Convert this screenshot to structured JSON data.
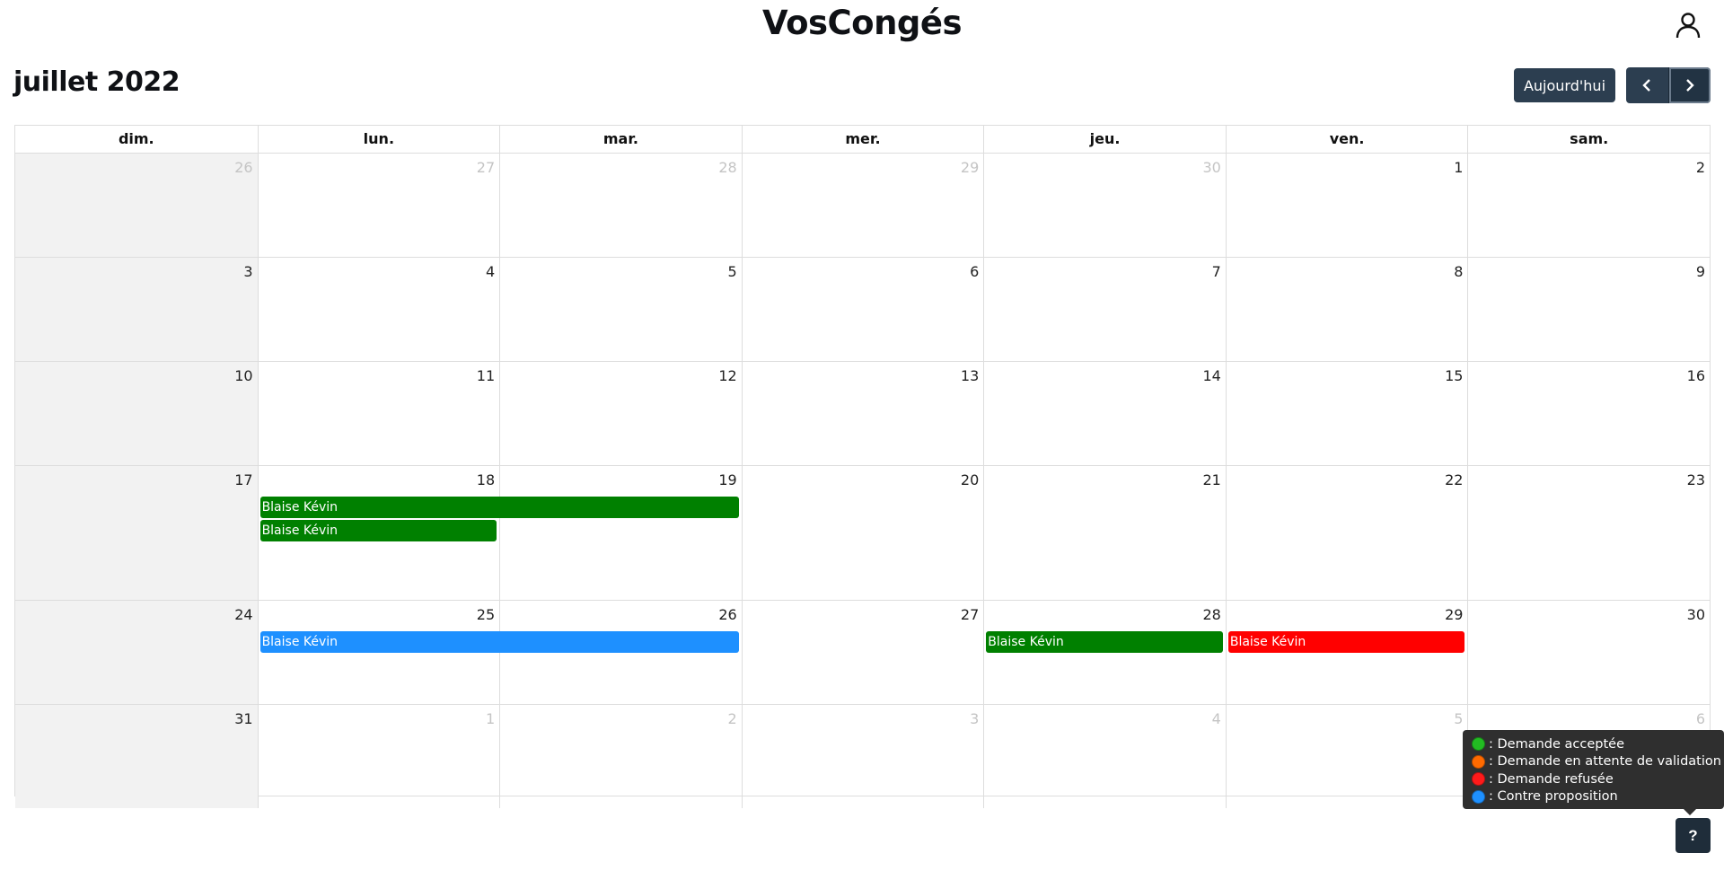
{
  "header": {
    "title": "VosCongés"
  },
  "toolbar": {
    "month_title": "juillet 2022",
    "today_label": "Aujourd'hui"
  },
  "calendar": {
    "weekdays": [
      "dim.",
      "lun.",
      "mar.",
      "mer.",
      "jeu.",
      "ven.",
      "sam."
    ],
    "weeks": [
      {
        "days": [
          {
            "num": "26",
            "other": true
          },
          {
            "num": "27",
            "other": true
          },
          {
            "num": "28",
            "other": true
          },
          {
            "num": "29",
            "other": true
          },
          {
            "num": "30",
            "other": true
          },
          {
            "num": "1",
            "other": false
          },
          {
            "num": "2",
            "other": false
          }
        ],
        "events": []
      },
      {
        "days": [
          {
            "num": "3",
            "other": false
          },
          {
            "num": "4",
            "other": false
          },
          {
            "num": "5",
            "other": false
          },
          {
            "num": "6",
            "other": false
          },
          {
            "num": "7",
            "other": false
          },
          {
            "num": "8",
            "other": false
          },
          {
            "num": "9",
            "other": false
          }
        ],
        "events": []
      },
      {
        "days": [
          {
            "num": "10",
            "other": false
          },
          {
            "num": "11",
            "other": false
          },
          {
            "num": "12",
            "other": false
          },
          {
            "num": "13",
            "other": false
          },
          {
            "num": "14",
            "other": false
          },
          {
            "num": "15",
            "other": false
          },
          {
            "num": "16",
            "other": false
          }
        ],
        "events": []
      },
      {
        "days": [
          {
            "num": "17",
            "other": false
          },
          {
            "num": "18",
            "other": false
          },
          {
            "num": "19",
            "other": false
          },
          {
            "num": "20",
            "other": false
          },
          {
            "num": "21",
            "other": false
          },
          {
            "num": "22",
            "other": false
          },
          {
            "num": "23",
            "other": false
          }
        ],
        "events": [
          {
            "label": "Blaise Kévin",
            "start": 1,
            "span": 2,
            "status": "accepted"
          },
          {
            "label": "Blaise Kévin",
            "start": 1,
            "span": 1,
            "status": "accepted"
          }
        ]
      },
      {
        "days": [
          {
            "num": "24",
            "other": false
          },
          {
            "num": "25",
            "other": false
          },
          {
            "num": "26",
            "other": false
          },
          {
            "num": "27",
            "other": false
          },
          {
            "num": "28",
            "other": false
          },
          {
            "num": "29",
            "other": false
          },
          {
            "num": "30",
            "other": false
          }
        ],
        "events": [
          {
            "label": "Blaise Kévin",
            "start": 1,
            "span": 2,
            "status": "counter"
          },
          {
            "label": "Blaise Kévin",
            "start": 4,
            "span": 1,
            "status": "accepted"
          },
          {
            "label": "Blaise Kévin",
            "start": 5,
            "span": 1,
            "status": "refused"
          }
        ]
      },
      {
        "days": [
          {
            "num": "31",
            "other": false
          },
          {
            "num": "1",
            "other": true
          },
          {
            "num": "2",
            "other": true
          },
          {
            "num": "3",
            "other": true
          },
          {
            "num": "4",
            "other": true
          },
          {
            "num": "5",
            "other": true
          },
          {
            "num": "6",
            "other": true
          }
        ],
        "events": []
      }
    ]
  },
  "status_colors": {
    "accepted": "#008000",
    "pending": "#ff6a00",
    "refused": "#ff0000",
    "counter": "#1e90ff"
  },
  "legend": {
    "items": [
      {
        "label": ": Demande acceptée",
        "color": "#22bb22"
      },
      {
        "label": ": Demande en attente de validation",
        "color": "#ff6a00"
      },
      {
        "label": ": Demande refusée",
        "color": "#ff1a1a"
      },
      {
        "label": ": Contre proposition",
        "color": "#1e90ff"
      }
    ]
  },
  "help": {
    "label": "?"
  },
  "icons": {
    "user": "user-icon",
    "prev": "chevron-left-icon",
    "next": "chevron-right-icon"
  }
}
